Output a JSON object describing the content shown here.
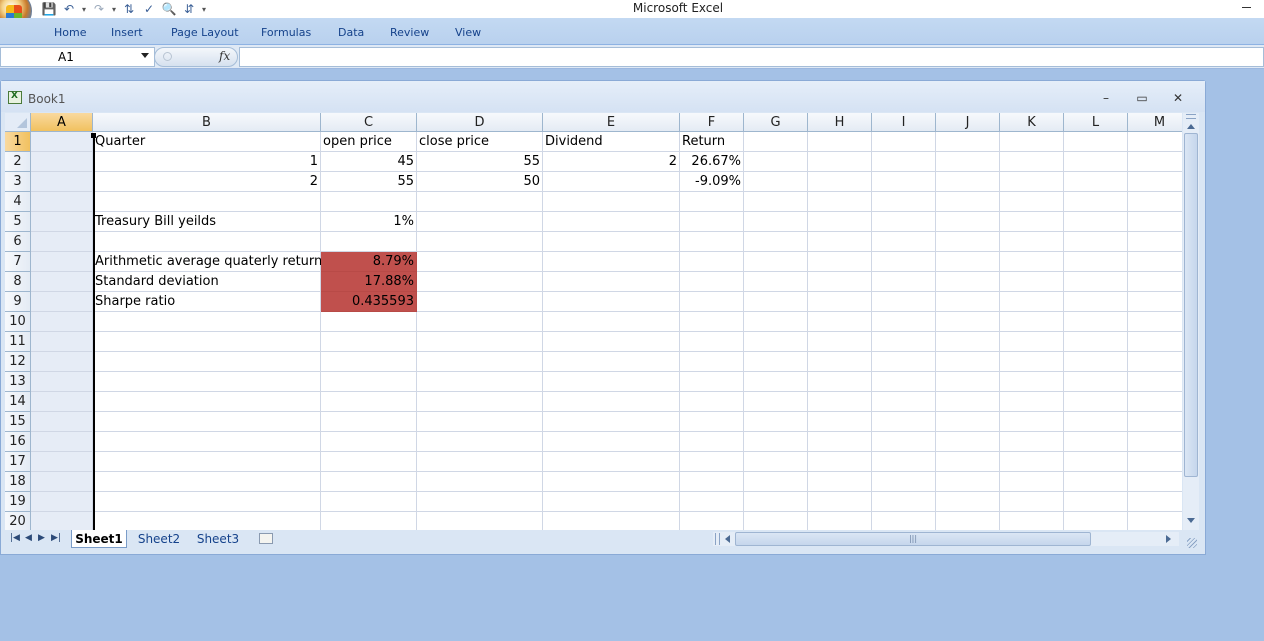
{
  "app": {
    "title": "Microsoft Excel"
  },
  "ribbon": {
    "tabs": [
      "Home",
      "Insert",
      "Page Layout",
      "Formulas",
      "Data",
      "Review",
      "View"
    ]
  },
  "formula_bar": {
    "name_box": "A1",
    "fx_label": "fx",
    "content": ""
  },
  "workbook": {
    "title": "Book1"
  },
  "columns": [
    "A",
    "B",
    "C",
    "D",
    "E",
    "F",
    "G",
    "H",
    "I",
    "J",
    "K",
    "L",
    "M"
  ],
  "rows": [
    "1",
    "2",
    "3",
    "4",
    "5",
    "6",
    "7",
    "8",
    "9",
    "10",
    "11",
    "12",
    "13",
    "14",
    "15",
    "16",
    "17",
    "18",
    "19",
    "20"
  ],
  "cells": {
    "B1": "Quarter",
    "C1": "open price",
    "D1": "close price",
    "E1": "Dividend",
    "F1": "Return",
    "B2": "1",
    "C2": "45",
    "D2": "55",
    "E2": "2",
    "F2": "26.67%",
    "B3": "2",
    "C3": "55",
    "D3": "50",
    "F3": "-9.09%",
    "B5": "Treasury Bill yeilds",
    "C5": "1%",
    "B7": "Arithmetic average quaterly return",
    "C7": "8.79%",
    "B8": "Standard deviation",
    "C8": "17.88%",
    "B9": "Sharpe ratio",
    "C9": "0.435593"
  },
  "highlight_color": "#c0504d",
  "sheets": [
    "Sheet1",
    "Sheet2",
    "Sheet3"
  ],
  "active_sheet": "Sheet1"
}
